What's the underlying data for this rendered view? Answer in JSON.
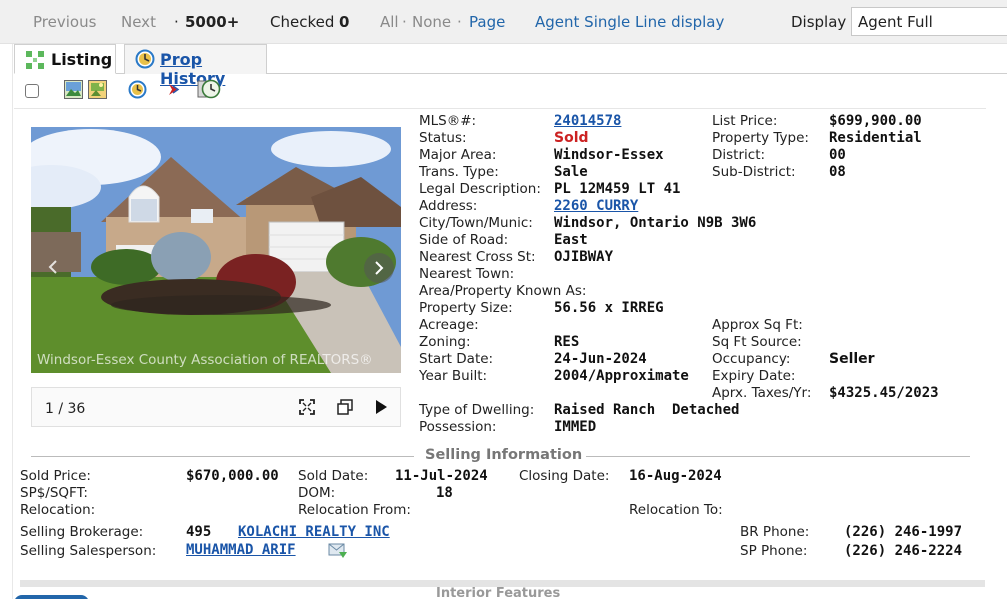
{
  "nav": {
    "previous": "Previous",
    "next": "Next",
    "count_prefix": "·",
    "count": "5000+",
    "checked_label": "Checked",
    "checked_count": "0",
    "all": "All",
    "none": "None",
    "sep": "·",
    "page": "Page",
    "single_line": "Agent Single Line display",
    "display_label": "Display",
    "display_value": "Agent Full"
  },
  "tabs": {
    "listing": "Listing",
    "history": "Prop History"
  },
  "photo": {
    "counter": "1 / 36",
    "watermark": "Windsor-Essex County Association of REALTORS®"
  },
  "details": {
    "mls_label": "MLS®#:",
    "mls": "24014578",
    "status_label": "Status:",
    "status": "Sold",
    "major_area_label": "Major Area:",
    "major_area": "Windsor-Essex",
    "trans_type_label": "Trans. Type:",
    "trans_type": "Sale",
    "legal_label": "Legal Description:",
    "legal": "PL 12M459 LT 41",
    "address_label": "Address:",
    "address": "2260 CURRY",
    "city_label": "City/Town/Munic:",
    "city": "Windsor, Ontario N9B 3W6",
    "side_label": "Side of Road:",
    "side": "East",
    "cross_label": "Nearest Cross St:",
    "cross": "OJIBWAY",
    "nearest_town_label": "Nearest Town:",
    "known_as_label": "Area/Property Known As:",
    "prop_size_label": "Property Size:",
    "prop_size": "56.56 x IRREG",
    "acreage_label": "Acreage:",
    "zoning_label": "Zoning:",
    "zoning": "RES",
    "start_label": "Start Date:",
    "start": "24-Jun-2024",
    "year_label": "Year Built:",
    "year": "2004/Approximate",
    "dwelling_label": "Type of Dwelling:",
    "dwelling": "Raised Ranch  Detached",
    "possession_label": "Possession:",
    "possession": "IMMED",
    "list_price_label": "List Price:",
    "list_price": "$699,900.00",
    "prop_type_label": "Property Type:",
    "prop_type": "Residential",
    "district_label": "District:",
    "district": "00",
    "sub_district_label": "Sub-District:",
    "sub_district": "08",
    "sqft_label": "Approx Sq Ft:",
    "sqft_source_label": "Sq Ft Source:",
    "occupancy_label": "Occupancy:",
    "occupancy": "Seller",
    "expiry_label": "Expiry Date:",
    "taxes_label": "Aprx. Taxes/Yr:",
    "taxes": "$4325.45/2023"
  },
  "selling": {
    "title": "Selling Information",
    "sold_price_label": "Sold Price:",
    "sold_price": "$670,000.00",
    "sold_date_label": "Sold Date:",
    "sold_date": "11-Jul-2024",
    "closing_label": "Closing Date:",
    "closing": "16-Aug-2024",
    "spsqft_label": "SP$/SQFT:",
    "dom_label": "DOM:",
    "dom": "18",
    "relocation_label": "Relocation:",
    "reloc_from_label": "Relocation From:",
    "reloc_to_label": "Relocation To:",
    "brokerage_label": "Selling Brokerage:",
    "brokerage_code": "495",
    "brokerage": "KOLACHI REALTY INC",
    "salesperson_label": "Selling Salesperson:",
    "salesperson": "MUHAMMAD ARIF",
    "br_phone_label": "BR Phone:",
    "br_phone": "(226) 246-1997",
    "sp_phone_label": "SP Phone:",
    "sp_phone": "(226) 246-2224"
  },
  "next_section": "Interior Features"
}
